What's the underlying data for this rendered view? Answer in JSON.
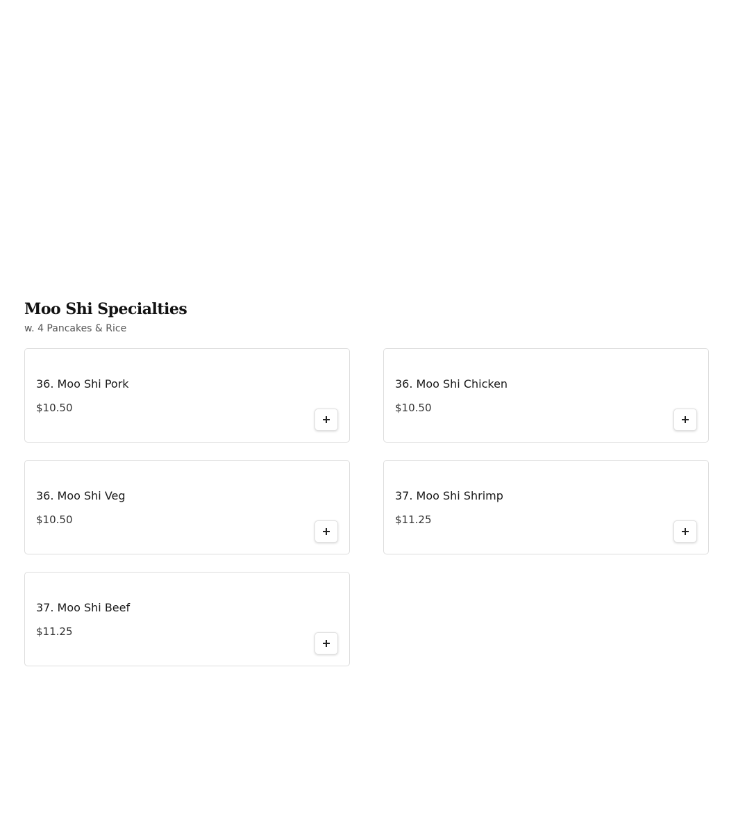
{
  "section": {
    "title": "Moo Shi Specialties",
    "subtitle": "w. 4 Pancakes & Rice"
  },
  "items": [
    {
      "name": "36. Moo Shi Pork",
      "price": "$10.50"
    },
    {
      "name": "36. Moo Shi Chicken",
      "price": "$10.50"
    },
    {
      "name": "36. Moo Shi Veg",
      "price": "$10.50"
    },
    {
      "name": "37. Moo Shi Shrimp",
      "price": "$11.25"
    },
    {
      "name": "37. Moo Shi Beef",
      "price": "$11.25"
    }
  ],
  "icons": {
    "add": "plus-icon"
  }
}
